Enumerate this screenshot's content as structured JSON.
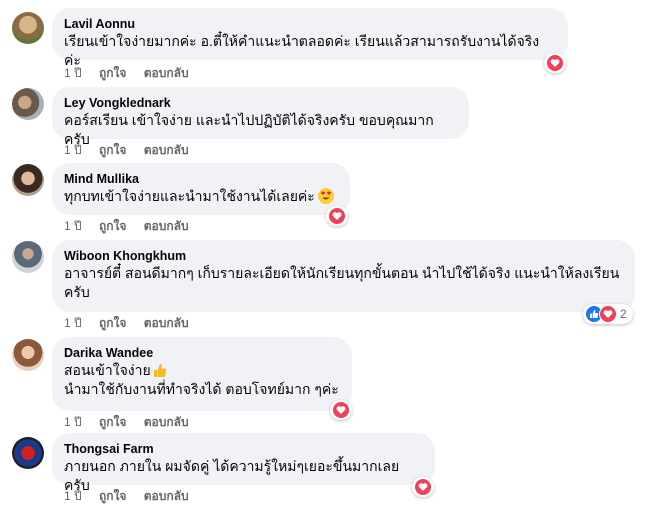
{
  "colors": {
    "bubble": "#f0f2f5",
    "meta": "#65676b",
    "love": "#f33e58",
    "like": "#1877f2"
  },
  "comments": [
    {
      "author": "Lavil Aonnu",
      "text": "เรียนเข้าใจง่ายมากค่ะ อ.ตี๋ให้คำแนะนำตลอดค่ะ เรียนแล้วสามารถรับงานได้จริงค่ะ",
      "time": "1 ปี",
      "like_label": "ถูกใจ",
      "reply_label": "ตอบกลับ",
      "reactions": [
        "love-icon"
      ]
    },
    {
      "author": "Ley Vongklednark",
      "text": "คอร์สเรียน เข้าใจง่าย และนำไปปฏิบัติได้จริงครับ ขอบคุณมากครับ",
      "time": "1 ปี",
      "like_label": "ถูกใจ",
      "reply_label": "ตอบกลับ",
      "reactions": []
    },
    {
      "author": "Mind Mullika",
      "text": "ทุกบทเข้าใจง่ายและนำมาใช้งานได้เลยค่ะ",
      "emoji": "heart-eyes-emoji",
      "time": "1 ปี",
      "like_label": "ถูกใจ",
      "reply_label": "ตอบกลับ",
      "reactions": [
        "love-icon"
      ]
    },
    {
      "author": "Wiboon Khongkhum",
      "text_line1": "อาจารย์ตี๋ สอนดีมากๆ เก็บรายละเอียดให้นักเรียนทุกขั้นตอน นำไปใช้ได้จริง แนะนำให้ลงเรียน",
      "text_line2": "ครับ",
      "time": "1 ปี",
      "like_label": "ถูกใจ",
      "reply_label": "ตอบกลับ",
      "reactions": [
        "like-icon",
        "love-icon"
      ],
      "reaction_count": "2"
    },
    {
      "author": "Darika Wandee",
      "text_line1": "สอนเข้าใจง่าย",
      "emoji": "thumbs-up-emoji",
      "text_line2": "นำมาใช้กับงานที่ทำจริงได้ ตอบโจทย์มาก ๆค่ะ",
      "time": "1 ปี",
      "like_label": "ถูกใจ",
      "reply_label": "ตอบกลับ",
      "reactions": [
        "love-icon"
      ]
    },
    {
      "author": "Thongsai Farm",
      "text": "ภายนอก ภายใน ผมจัดคู่ ได้ความรู้ใหม่ๆเยอะขึ้นมากเลยครับ",
      "time": "1 ปี",
      "like_label": "ถูกใจ",
      "reply_label": "ตอบกลับ",
      "reactions": [
        "love-icon"
      ]
    }
  ]
}
